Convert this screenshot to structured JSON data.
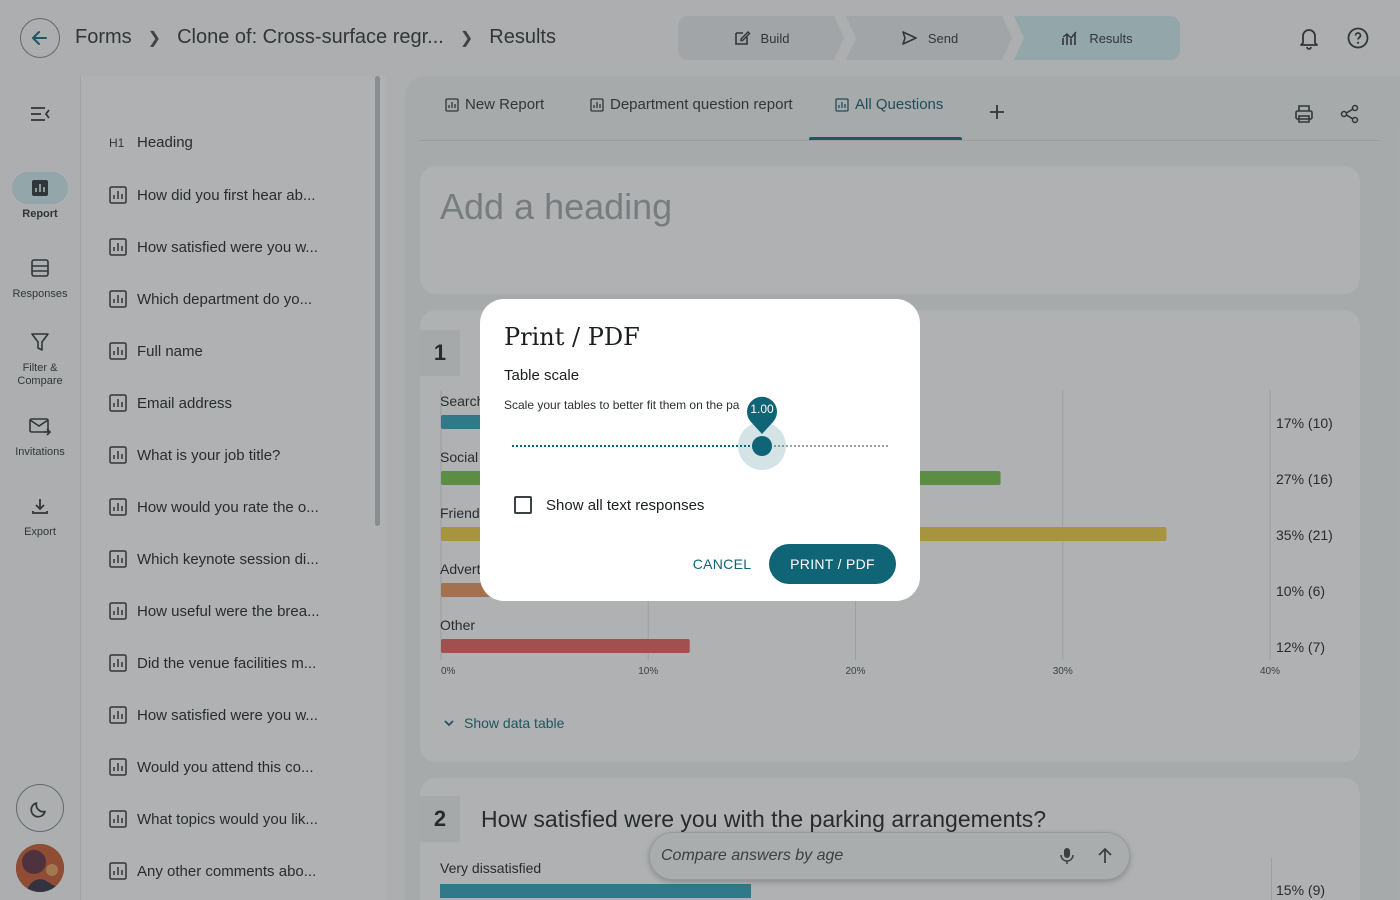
{
  "breadcrumb": {
    "items": [
      "Forms",
      "Clone of: Cross-surface regr...",
      "Results"
    ]
  },
  "stepper": {
    "steps": [
      {
        "label": "Build",
        "icon": "edit-icon"
      },
      {
        "label": "Send",
        "icon": "send-icon"
      },
      {
        "label": "Results",
        "icon": "analytics-icon",
        "active": true
      }
    ]
  },
  "rail": {
    "items": [
      {
        "label": "Report",
        "icon": "report-icon",
        "active": true
      },
      {
        "label": "Responses",
        "icon": "responses-icon"
      },
      {
        "label": "Filter & Compare",
        "icon": "filter-icon"
      },
      {
        "label": "Invitations",
        "icon": "invitations-icon"
      },
      {
        "label": "Export",
        "icon": "export-icon"
      }
    ]
  },
  "questions": {
    "heading_tag": "H1",
    "heading_label": "Heading",
    "items": [
      "How did you first hear ab...",
      "How satisfied were you w...",
      "Which department do yo...",
      "Full name",
      "Email address",
      "What is your job title?",
      "How would you rate the o...",
      "Which keynote session di...",
      "How useful were the brea...",
      "Did the venue facilities m...",
      "How satisfied were you w...",
      "Would you attend this co...",
      "What topics would you lik...",
      "Any other comments abo..."
    ]
  },
  "report_tabs": {
    "items": [
      "New Report",
      "Department question report",
      "All Questions"
    ],
    "active": "All Questions"
  },
  "heading_card": {
    "placeholder": "Add a heading"
  },
  "q1": {
    "number": "1",
    "show_table_label": "Show data table"
  },
  "q2": {
    "number": "2",
    "title": "How satisfied were you with the parking arrangements?",
    "first_category": "Very dissatisfied",
    "first_value_label": "15% (9)"
  },
  "compare": {
    "placeholder": "Compare answers by age"
  },
  "dialog": {
    "title": "Print / PDF",
    "subtitle": "Table scale",
    "description": "Scale your tables to better fit them on the pa",
    "slider_value": "1.00",
    "slider_fraction": 0.665,
    "checkbox_label": "Show all text responses",
    "checkbox_checked": false,
    "cancel_label": "CANCEL",
    "confirm_label": "PRINT / PDF"
  },
  "chart_data": {
    "type": "bar",
    "orientation": "horizontal",
    "categories": [
      "Search",
      "Social",
      "Friend",
      "Advert",
      "Other"
    ],
    "values": [
      17,
      27,
      35,
      10,
      12
    ],
    "counts": [
      10,
      16,
      21,
      6,
      7
    ],
    "value_labels": [
      "17% (10)",
      "27% (16)",
      "35% (21)",
      "10% (6)",
      "12% (7)"
    ],
    "colors": [
      "#2b9cb3",
      "#6fbf45",
      "#e8c83c",
      "#e0915a",
      "#e05a5a"
    ],
    "xlim": [
      0,
      40
    ],
    "xticks": [
      "0%",
      "10%",
      "20%",
      "30%",
      "40%"
    ],
    "grid": true
  },
  "colors": {
    "accent": "#0f6475",
    "results_step": "#c8e5ea"
  }
}
